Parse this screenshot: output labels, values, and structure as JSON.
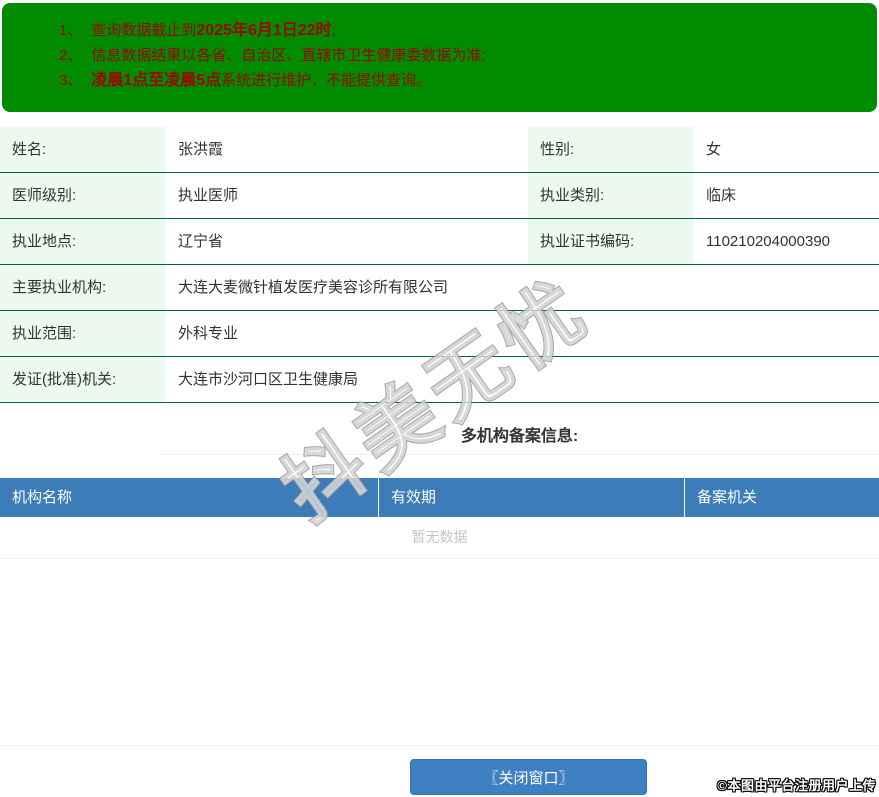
{
  "colors": {
    "banner_green": "#008b00",
    "notice_red": "#9b0606",
    "row_border_green": "#006838",
    "label_bg_mint": "#ecf9f1",
    "header_blue": "#3c7cb8",
    "button_blue": "#3e80c1",
    "empty_text_gray": "#c4c4c4"
  },
  "notice": {
    "items": [
      {
        "num": "1、",
        "segments": [
          {
            "t": "查询数据截止到",
            "b": false
          },
          {
            "t": "2025年6月1日22时",
            "b": true
          },
          {
            "t": ";",
            "b": false
          }
        ]
      },
      {
        "num": "2、",
        "segments": [
          {
            "t": "信息数据结果以各省、自治区、直辖市卫生健康委数据为准;",
            "b": false
          }
        ]
      },
      {
        "num": "3、",
        "segments": [
          {
            "t": "凌晨1点至凌晨5点",
            "b": true
          },
          {
            "t": "系统进行维护，不能提供查询。",
            "b": false
          }
        ]
      }
    ]
  },
  "info_table": {
    "rows": [
      {
        "cells": [
          {
            "label": "姓名:",
            "value": "张洪霞"
          },
          {
            "label": "性别:",
            "value": "女"
          }
        ]
      },
      {
        "cells": [
          {
            "label": "医师级别:",
            "value": "执业医师"
          },
          {
            "label": "执业类别:",
            "value": "临床"
          }
        ]
      },
      {
        "cells": [
          {
            "label": "执业地点:",
            "value": "辽宁省"
          },
          {
            "label": "执业证书编码:",
            "value": "110210204000390"
          }
        ]
      },
      {
        "cells": [
          {
            "label": "主要执业机构:",
            "value": "大连大麦微针植发医疗美容诊所有限公司"
          }
        ]
      },
      {
        "cells": [
          {
            "label": "执业范围:",
            "value": "外科专业"
          }
        ]
      },
      {
        "cells": [
          {
            "label": "发证(批准)机关:",
            "value": "大连市沙河口区卫生健康局"
          }
        ]
      }
    ]
  },
  "sections": {
    "multi_org_heading": "多机构备案信息:"
  },
  "record_table": {
    "columns": [
      "机构名称",
      "有效期",
      "备案机关"
    ],
    "empty_text": "暂无数据"
  },
  "footer": {
    "close_button_label": "〖关闭窗口〗",
    "copyright": "©本图由平台注册用户上传"
  },
  "watermark": {
    "text": "抖美无忧"
  }
}
